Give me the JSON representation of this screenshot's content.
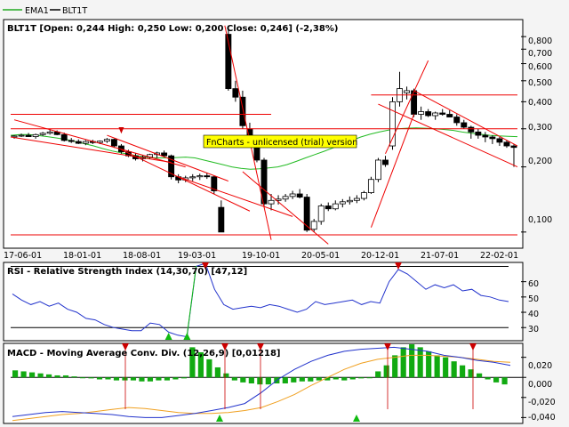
{
  "legend": {
    "ema_label": "EMA1",
    "series_label": "BLT1T",
    "ema_color": "#22aa22",
    "series_color": "#000000"
  },
  "watermark": "FnCharts - unlicensed (trial) version",
  "colors": {
    "trend_line": "#ee0000",
    "ema": "#22bb22",
    "rsi": "#2233cc",
    "macd": "#2233cc",
    "signal": "#f0a020",
    "hist": "#11aa11",
    "buy_marker": "#11bb11",
    "sell_marker": "#cc0000"
  },
  "price_panel": {
    "title": "BLT1T [Open: 0,244  High: 0,250  Low: 0,200  Close: 0,246] (-2,38%)",
    "yticks": [
      "0,800",
      "0,700",
      "0,600",
      "0,500",
      "0,400",
      "0,300",
      "0,200",
      "0,100"
    ]
  },
  "x_axis": {
    "labels": [
      "17-06-01",
      "18-01-01",
      "18-08-01",
      "19-03-01",
      "19-10-01",
      "20-05-01",
      "20-12-01",
      "21-07-01",
      "22-02-01"
    ]
  },
  "rsi_panel": {
    "title": "RSI - Relative Strength Index (14,30,70) [47,12]",
    "yticks": [
      "60",
      "50",
      "40",
      "30"
    ]
  },
  "macd_panel": {
    "title": "MACD - Moving Average Conv. Div. (12,26,9) [0,01218]",
    "yticks": [
      "0,020",
      "0,000",
      "-0,020",
      "-0,040"
    ]
  },
  "chart_data": [
    {
      "type": "candlestick",
      "title": "BLT1T [Open: 0,244  High: 0,250  Low: 0,200  Close: 0,246] (-2,38%)",
      "scale": "log",
      "ylim": [
        0.085,
        0.95
      ],
      "x_labels": [
        "17-06-01",
        "18-01-01",
        "18-08-01",
        "19-03-01",
        "19-10-01",
        "20-05-01",
        "20-12-01",
        "21-07-01",
        "22-02-01"
      ],
      "candles": [
        [
          0.275,
          0.28,
          0.27,
          0.278
        ],
        [
          0.278,
          0.285,
          0.275,
          0.28
        ],
        [
          0.28,
          0.287,
          0.275,
          0.276
        ],
        [
          0.276,
          0.285,
          0.27,
          0.282
        ],
        [
          0.282,
          0.29,
          0.278,
          0.286
        ],
        [
          0.286,
          0.3,
          0.282,
          0.29
        ],
        [
          0.29,
          0.295,
          0.28,
          0.282
        ],
        [
          0.282,
          0.288,
          0.262,
          0.265
        ],
        [
          0.265,
          0.272,
          0.258,
          0.262
        ],
        [
          0.262,
          0.268,
          0.255,
          0.257
        ],
        [
          0.257,
          0.266,
          0.252,
          0.262
        ],
        [
          0.262,
          0.267,
          0.255,
          0.259
        ],
        [
          0.259,
          0.265,
          0.255,
          0.263
        ],
        [
          0.263,
          0.272,
          0.258,
          0.268
        ],
        [
          0.268,
          0.27,
          0.245,
          0.25
        ],
        [
          0.25,
          0.255,
          0.23,
          0.235
        ],
        [
          0.235,
          0.24,
          0.222,
          0.225
        ],
        [
          0.225,
          0.232,
          0.214,
          0.218
        ],
        [
          0.218,
          0.226,
          0.212,
          0.222
        ],
        [
          0.222,
          0.23,
          0.218,
          0.228
        ],
        [
          0.228,
          0.235,
          0.22,
          0.232
        ],
        [
          0.232,
          0.238,
          0.222,
          0.225
        ],
        [
          0.225,
          0.228,
          0.175,
          0.18
        ],
        [
          0.18,
          0.185,
          0.168,
          0.174
        ],
        [
          0.174,
          0.182,
          0.17,
          0.178
        ],
        [
          0.178,
          0.185,
          0.172,
          0.18
        ],
        [
          0.18,
          0.186,
          0.174,
          0.182
        ],
        [
          0.182,
          0.188,
          0.176,
          0.18
        ],
        [
          0.18,
          0.182,
          0.15,
          0.155
        ],
        [
          0.13,
          0.14,
          0.1,
          0.1
        ],
        [
          0.82,
          0.9,
          0.45,
          0.46
        ],
        [
          0.46,
          0.5,
          0.4,
          0.42
        ],
        [
          0.42,
          0.45,
          0.3,
          0.31
        ],
        [
          0.3,
          0.32,
          0.25,
          0.26
        ],
        [
          0.26,
          0.27,
          0.21,
          0.215
        ],
        [
          0.215,
          0.22,
          0.13,
          0.135
        ],
        [
          0.135,
          0.15,
          0.126,
          0.14
        ],
        [
          0.14,
          0.148,
          0.134,
          0.142
        ],
        [
          0.142,
          0.15,
          0.138,
          0.146
        ],
        [
          0.146,
          0.155,
          0.142,
          0.15
        ],
        [
          0.15,
          0.158,
          0.143,
          0.145
        ],
        [
          0.145,
          0.15,
          0.1,
          0.102
        ],
        [
          0.103,
          0.115,
          0.1,
          0.112
        ],
        [
          0.112,
          0.135,
          0.108,
          0.132
        ],
        [
          0.132,
          0.137,
          0.125,
          0.128
        ],
        [
          0.128,
          0.14,
          0.126,
          0.135
        ],
        [
          0.135,
          0.142,
          0.13,
          0.138
        ],
        [
          0.138,
          0.146,
          0.134,
          0.14
        ],
        [
          0.14,
          0.148,
          0.136,
          0.143
        ],
        [
          0.143,
          0.155,
          0.14,
          0.152
        ],
        [
          0.152,
          0.18,
          0.15,
          0.175
        ],
        [
          0.175,
          0.22,
          0.17,
          0.215
        ],
        [
          0.215,
          0.225,
          0.2,
          0.205
        ],
        [
          0.25,
          0.42,
          0.24,
          0.4
        ],
        [
          0.4,
          0.55,
          0.38,
          0.46
        ],
        [
          0.44,
          0.47,
          0.41,
          0.45
        ],
        [
          0.45,
          0.46,
          0.34,
          0.35
        ],
        [
          0.35,
          0.38,
          0.33,
          0.36
        ],
        [
          0.36,
          0.37,
          0.34,
          0.345
        ],
        [
          0.345,
          0.36,
          0.33,
          0.355
        ],
        [
          0.355,
          0.37,
          0.345,
          0.35
        ],
        [
          0.35,
          0.365,
          0.34,
          0.34
        ],
        [
          0.34,
          0.35,
          0.31,
          0.32
        ],
        [
          0.32,
          0.33,
          0.3,
          0.305
        ],
        [
          0.305,
          0.31,
          0.27,
          0.29
        ],
        [
          0.29,
          0.3,
          0.27,
          0.28
        ],
        [
          0.28,
          0.29,
          0.26,
          0.275
        ],
        [
          0.275,
          0.28,
          0.255,
          0.27
        ],
        [
          0.27,
          0.275,
          0.25,
          0.26
        ],
        [
          0.26,
          0.265,
          0.245,
          0.25
        ],
        [
          0.25,
          0.255,
          0.2,
          0.246
        ]
      ],
      "ema": [
        0.28,
        0.282,
        0.282,
        0.279,
        0.276,
        0.272,
        0.268,
        0.262,
        0.256,
        0.25,
        0.243,
        0.237,
        0.232,
        0.228,
        0.224,
        0.221,
        0.22,
        0.22,
        0.221,
        0.222,
        0.22,
        0.215,
        0.21,
        0.205,
        0.2,
        0.197,
        0.195,
        0.196,
        0.198,
        0.2,
        0.205,
        0.212,
        0.22,
        0.228,
        0.236,
        0.245,
        0.255,
        0.265,
        0.275,
        0.283,
        0.29,
        0.296,
        0.3,
        0.302,
        0.303,
        0.302,
        0.3,
        0.298,
        0.295,
        0.29,
        0.286,
        0.283,
        0.28,
        0.278,
        0.277,
        0.276
      ],
      "trend_lines": "red support/resistance and trend lines"
    },
    {
      "type": "line",
      "title": "RSI - Relative Strength Index (14,30,70) [47,12]",
      "ylim": [
        22,
        72
      ],
      "levels": [
        30,
        70
      ],
      "values": [
        52,
        48,
        45,
        47,
        44,
        46,
        42,
        40,
        36,
        35,
        32,
        30,
        29,
        28,
        28,
        33,
        32,
        27,
        25,
        24,
        70,
        72,
        55,
        45,
        42,
        43,
        44,
        43,
        45,
        44,
        42,
        40,
        42,
        47,
        45,
        46,
        47,
        48,
        45,
        47,
        46,
        60,
        68,
        65,
        60,
        55,
        58,
        56,
        58,
        54,
        55,
        51,
        50,
        48,
        47
      ]
    },
    {
      "type": "bar+line",
      "title": "MACD - Moving Average Conv. Div. (12,26,9) [0,01218]",
      "ylim": [
        -0.045,
        0.033
      ],
      "histogram": [
        0.007,
        0.006,
        0.005,
        0.004,
        0.003,
        0.002,
        0.002,
        0.001,
        0.0,
        -0.001,
        -0.002,
        -0.002,
        -0.003,
        -0.003,
        -0.003,
        -0.004,
        -0.004,
        -0.003,
        -0.003,
        -0.002,
        -0.001,
        0.03,
        0.025,
        0.018,
        0.01,
        0.004,
        -0.003,
        -0.005,
        -0.006,
        -0.007,
        -0.007,
        -0.006,
        -0.006,
        -0.005,
        -0.004,
        -0.004,
        -0.003,
        -0.003,
        -0.002,
        -0.003,
        -0.002,
        -0.001,
        0.0,
        0.006,
        0.012,
        0.022,
        0.03,
        0.033,
        0.03,
        0.026,
        0.022,
        0.02,
        0.016,
        0.012,
        0.008,
        0.004,
        -0.002,
        -0.005,
        -0.007
      ],
      "macd": [
        -0.039,
        -0.037,
        -0.035,
        -0.034,
        -0.035,
        -0.036,
        -0.037,
        -0.039,
        -0.04,
        -0.04,
        -0.038,
        -0.036,
        -0.033,
        -0.03,
        -0.026,
        -0.015,
        -0.002,
        0.008,
        0.016,
        0.022,
        0.026,
        0.028,
        0.029,
        0.03,
        0.028,
        0.026,
        0.022,
        0.02,
        0.017,
        0.015,
        0.012
      ],
      "signal": [
        -0.043,
        -0.041,
        -0.039,
        -0.037,
        -0.036,
        -0.034,
        -0.032,
        -0.03,
        -0.031,
        -0.033,
        -0.035,
        -0.036,
        -0.036,
        -0.035,
        -0.033,
        -0.03,
        -0.024,
        -0.017,
        -0.008,
        0.0,
        0.008,
        0.014,
        0.018,
        0.02,
        0.022,
        0.022,
        0.021,
        0.02,
        0.018,
        0.016,
        0.015
      ]
    }
  ]
}
